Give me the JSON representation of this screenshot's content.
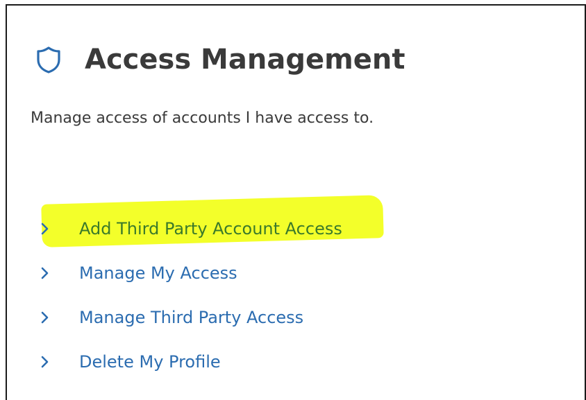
{
  "page": {
    "title": "Access Management",
    "subtitle": "Manage access of accounts I have access to.",
    "accent_color": "#2b6cb0",
    "highlight_color": "#f3ff2a",
    "title_icon": "shield-icon"
  },
  "links": [
    {
      "label": "Add Third Party Account Access",
      "icon": "chevron-right-icon",
      "highlighted": true
    },
    {
      "label": "Manage My Access",
      "icon": "chevron-right-icon",
      "highlighted": false
    },
    {
      "label": "Manage Third Party Access",
      "icon": "chevron-right-icon",
      "highlighted": false
    },
    {
      "label": "Delete My Profile",
      "icon": "chevron-right-icon",
      "highlighted": false
    }
  ]
}
